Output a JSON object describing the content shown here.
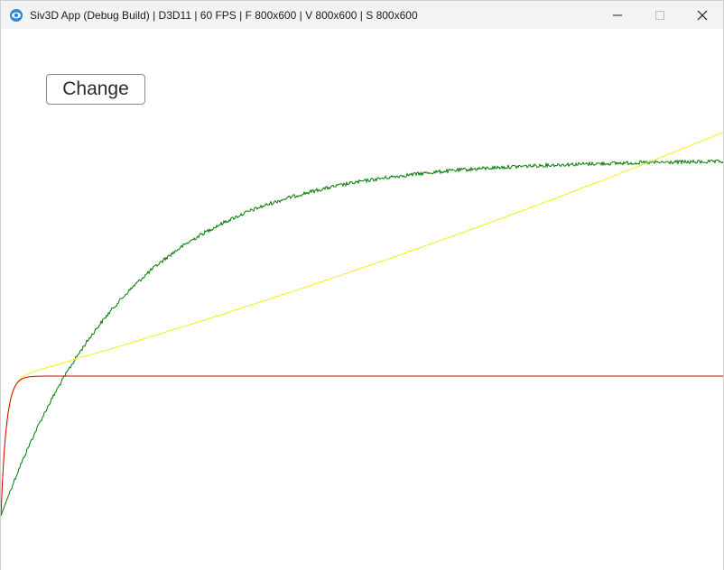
{
  "window": {
    "title": "Siv3D App (Debug Build) | D3D11 | 60 FPS | F 800x600 | V 800x600 | S 800x600",
    "icon": "siv3d-app-icon",
    "controls": {
      "minimize_icon": "minimize-icon",
      "maximize_icon": "maximize-icon",
      "close_icon": "close-icon"
    }
  },
  "app": {
    "change_button_label": "Change"
  },
  "plot": {
    "background": "#ffffff",
    "curves": [
      {
        "color": "#007a00",
        "noise": "high"
      },
      {
        "color": "#f5ee1e",
        "noise": "low"
      },
      {
        "color": "#d20000",
        "noise": "none"
      }
    ]
  }
}
